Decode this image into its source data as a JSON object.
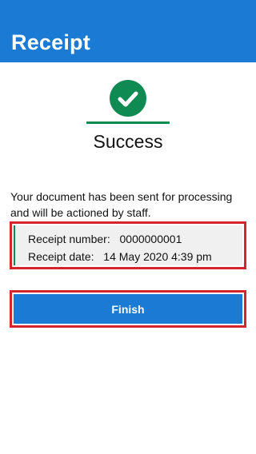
{
  "header": {
    "title": "Receipt"
  },
  "status": {
    "icon": "check-circle-icon",
    "label": "Success"
  },
  "message": "Your document has been sent for processing and will be actioned by staff.",
  "receipt": {
    "number_label": "Receipt number:",
    "number_value": "0000000001",
    "date_label": "Receipt date:",
    "date_value": "14 May 2020 4:39 pm"
  },
  "actions": {
    "finish_label": "Finish"
  },
  "colors": {
    "brand_blue": "#1a7ad4",
    "success_green": "#0f8a52",
    "highlight_red": "#d4242e"
  }
}
